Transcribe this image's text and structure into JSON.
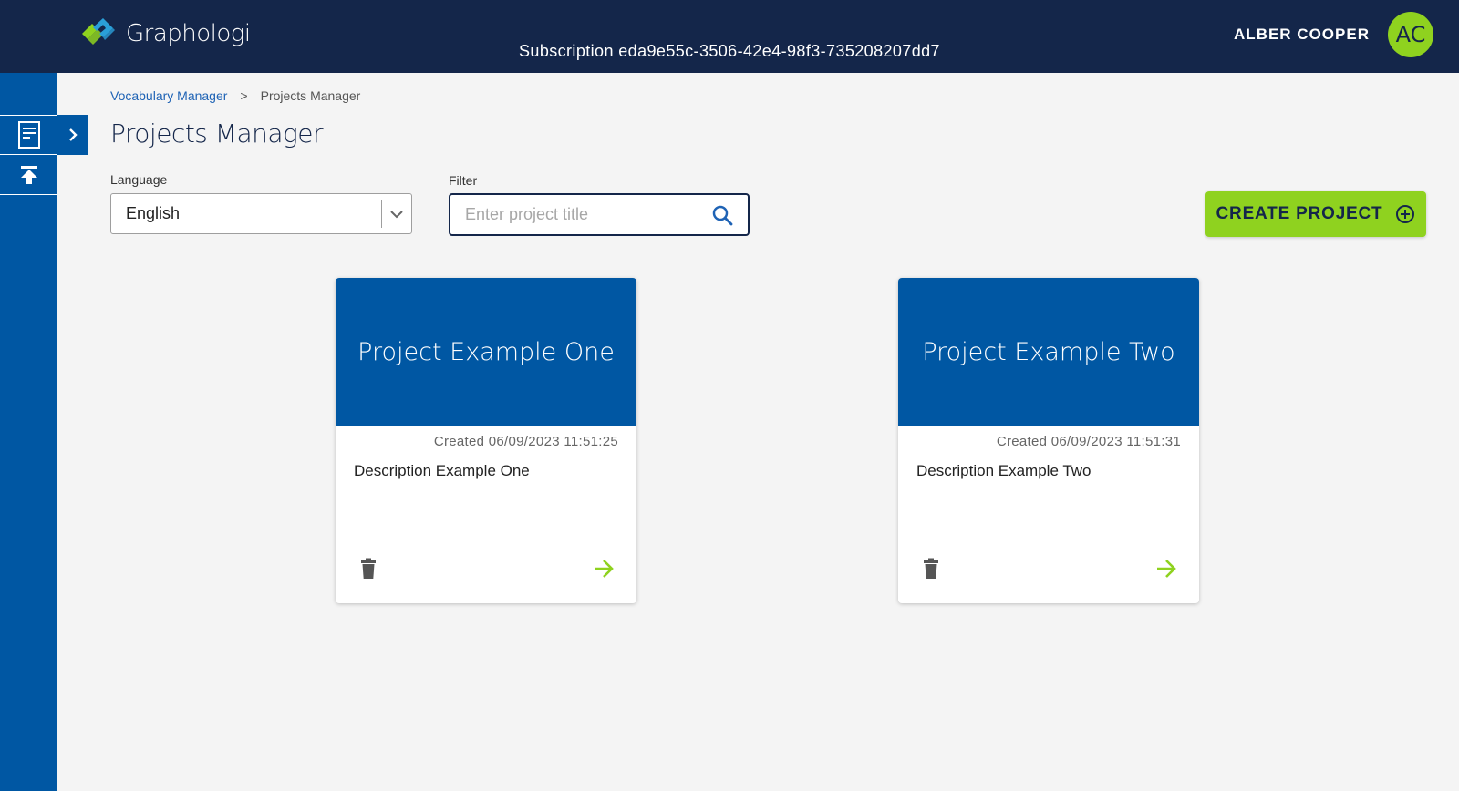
{
  "app": {
    "name": "Graphologi",
    "subscription": "Subscription eda9e55c-3506-42e4-98f3-735208207dd7"
  },
  "user": {
    "name": "ALBER COOPER",
    "initials": "AC"
  },
  "breadcrumb": {
    "parent": "Vocabulary Manager",
    "separator": ">",
    "current": "Projects Manager"
  },
  "page": {
    "title": "Projects Manager"
  },
  "filters": {
    "language_label": "Language",
    "language_value": "English",
    "filter_label": "Filter",
    "filter_placeholder": "Enter project title",
    "filter_value": ""
  },
  "actions": {
    "create_label": "CREATE PROJECT"
  },
  "projects": [
    {
      "title": "Project Example One",
      "created": "Created 06/09/2023 11:51:25",
      "description": "Description Example One"
    },
    {
      "title": "Project Example Two",
      "created": "Created 06/09/2023 11:51:31",
      "description": "Description Example Two"
    }
  ],
  "colors": {
    "topbar": "#14264a",
    "sidebar": "#0057a3",
    "accent_green": "#8fd21f",
    "card_header": "#0057a3",
    "link": "#1f63b5"
  },
  "icons": {
    "logo": "graphologi-logo-icon",
    "sidebar_top": "document-icon",
    "sidebar_bottom": "upload-icon",
    "expand": "chevron-right-icon",
    "dropdown": "chevron-down-icon",
    "search": "search-icon",
    "create": "add-circle-icon",
    "delete": "trash-icon",
    "open": "arrow-right-icon"
  }
}
